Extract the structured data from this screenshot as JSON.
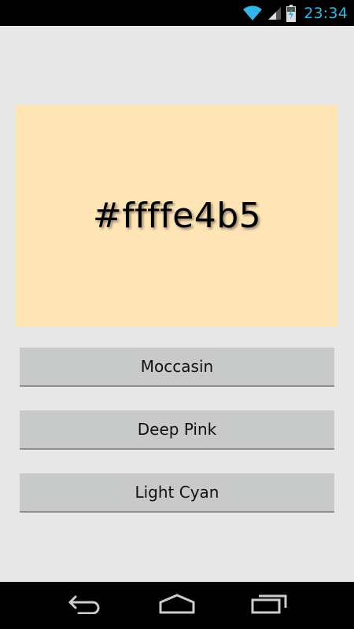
{
  "status_bar": {
    "time": "23:34",
    "icons": [
      "wifi-icon",
      "signal-icon",
      "battery-charging-icon"
    ],
    "accent_color": "#33b5e5"
  },
  "swatch": {
    "color_code": "#ffffe4b5",
    "background_color": "#ffe4b5"
  },
  "buttons": [
    {
      "label": "Moccasin"
    },
    {
      "label": "Deep Pink"
    },
    {
      "label": "Light Cyan"
    }
  ],
  "nav_bar": {
    "icons": [
      "back-icon",
      "home-icon",
      "recent-apps-icon"
    ]
  }
}
